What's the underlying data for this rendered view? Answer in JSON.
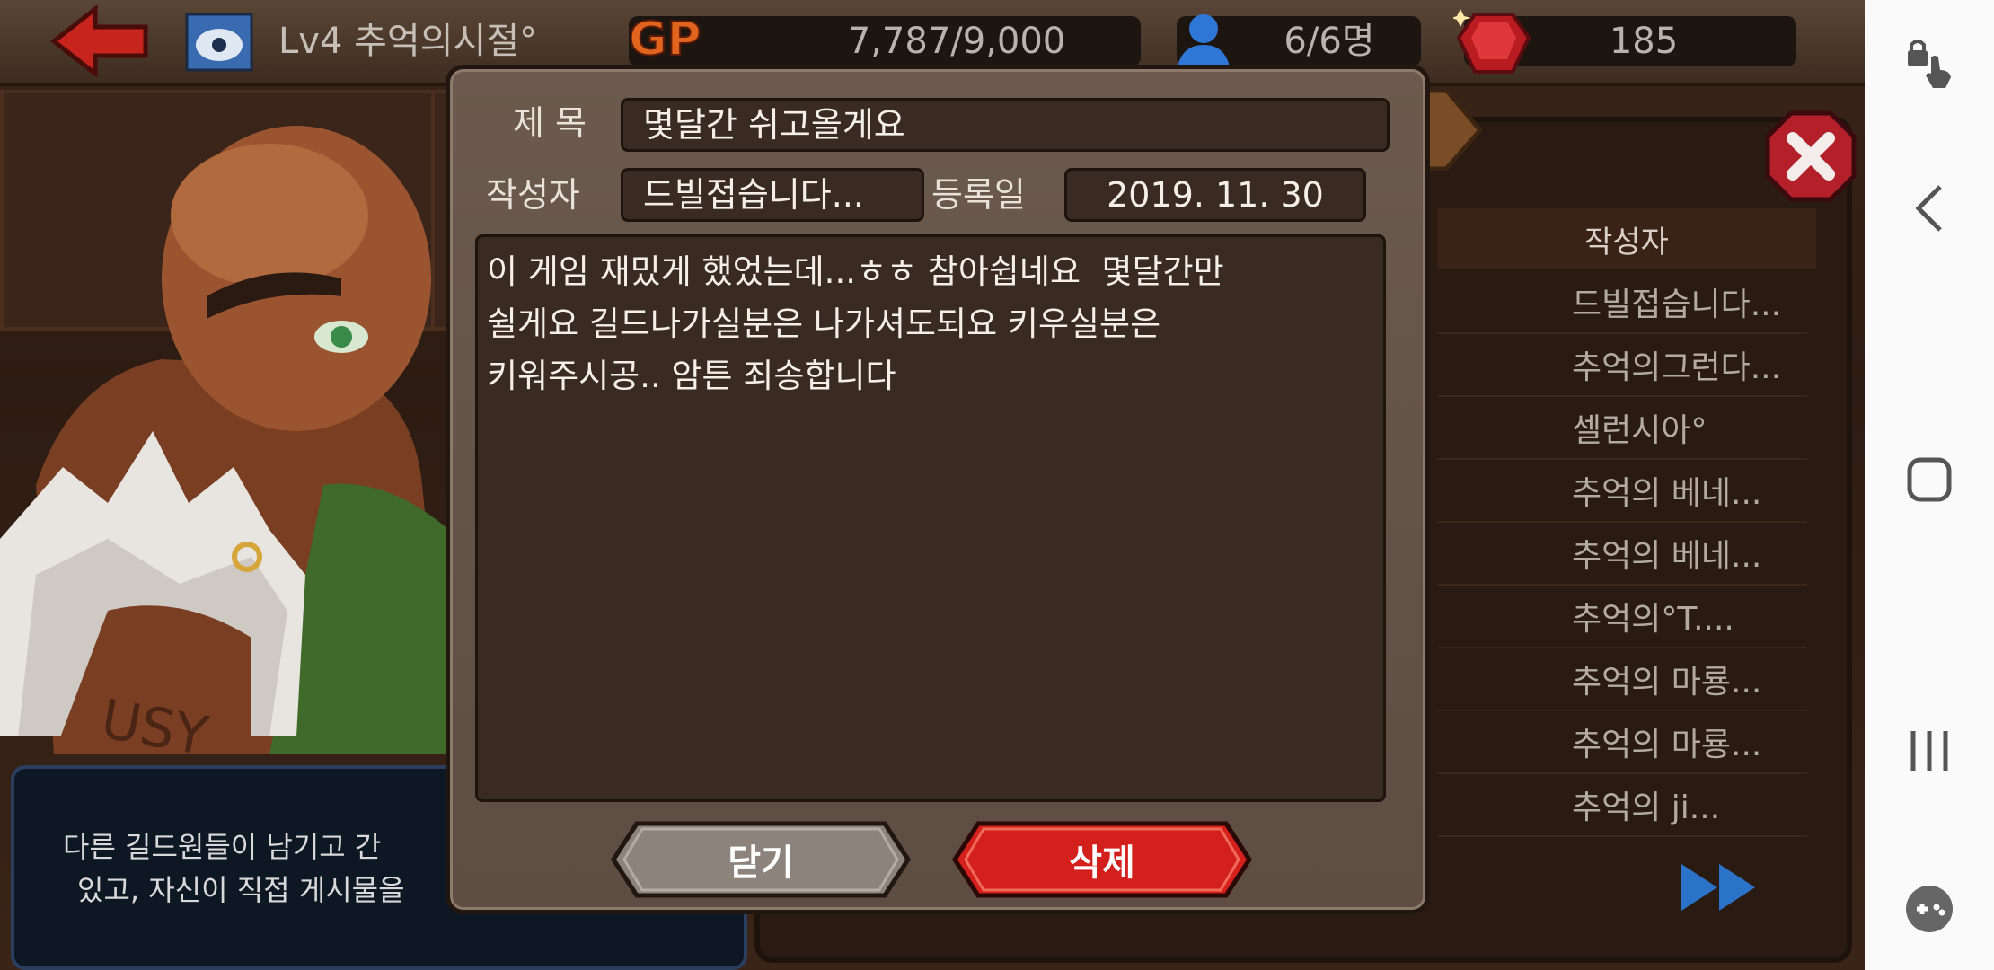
{
  "hud": {
    "level_name": "Lv4 추억의시절°",
    "gp_label": "GP",
    "gp_value": "7,787/9,000",
    "members": "6/6명",
    "gems": "185"
  },
  "info_box": {
    "line1": "다른 길드원들이 남기고 간",
    "line2": "있고, 자신이 직접 게시물을"
  },
  "board": {
    "author_header": "작성자",
    "authors": [
      "드빌접습니다...",
      "추억의그런다...",
      "셀런시아°",
      "추억의 베네...",
      "추억의 베네...",
      "추억의°T....",
      "추억의 마룡...",
      "추억의 마룡...",
      "추억의 ji..."
    ]
  },
  "post": {
    "title_label": "제 목",
    "title_value": "몇달간 쉬고올게요",
    "author_label": "작성자",
    "author_value": "드빌접습니다...",
    "date_label": "등록일",
    "date_value": "2019. 11. 30",
    "body": "이 게임 재밌게 했었는데...ㅎㅎ 참아쉽네요  몇달간만\n쉴게요 길드나가실분은 나가셔도되요 키우실분은\n키워주시공.. 암튼 죄송합니다",
    "close_button": "닫기",
    "delete_button": "삭제"
  },
  "colors": {
    "delete_red": "#d4201c",
    "close_gray": "#8b837c",
    "gp_orange": "#e0641e"
  },
  "icons": [
    "back-arrow-icon",
    "guild-emblem-icon",
    "members-icon",
    "gem-icon",
    "close-x-icon",
    "fast-forward-icon",
    "lock-touch-icon",
    "nav-back-icon",
    "nav-home-icon",
    "nav-recents-icon",
    "game-tools-icon"
  ]
}
